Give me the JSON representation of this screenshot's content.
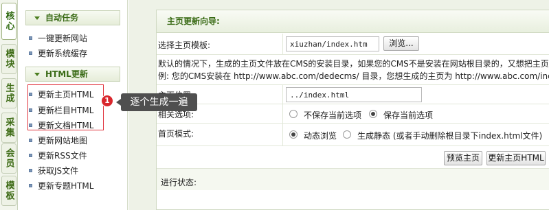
{
  "vertical_tabs": [
    {
      "label": "核心",
      "active": true
    },
    {
      "label": "模块",
      "active": false
    },
    {
      "label": "生成",
      "active": false
    },
    {
      "label": "采集",
      "active": false
    },
    {
      "label": "会员",
      "active": false
    },
    {
      "label": "模板",
      "active": false
    }
  ],
  "menu": {
    "section1": {
      "title": "自动任务",
      "items": [
        "一键更新网站",
        "更新系统缓存"
      ]
    },
    "section2": {
      "title": "HTML更新",
      "items": [
        "更新主页HTML",
        "更新栏目HTML",
        "更新文档HTML",
        "更新网站地图",
        "更新RSS文件",
        "获取JS文件",
        "更新专题HTML"
      ]
    }
  },
  "annotation": {
    "badge": "1",
    "text": "逐个生成一遍"
  },
  "panel": {
    "title": "主页更新向导:",
    "template_label": "选择主页模板:",
    "template_value": "xiuzhan/index.htm",
    "browse_button": "浏览...",
    "note_line1": "默认的情况下，生成的主页文件放在CMS的安装目录，如果您的CMS不是安装在网站根目录的，又想把主页创建",
    "note_line2": "例: 您的CMS安装在 http://www.abc.com/dedecms/ 目录，您想生成的主页为 http://www.abc.com/index.h",
    "position_label": "主页位置:",
    "position_value": "../index.html",
    "options_label": "相关选项:",
    "option_no_save": "不保存当前选项",
    "option_save": "保存当前选项",
    "mode_label": "首页模式:",
    "mode_dynamic": "动态浏览",
    "mode_static": "生成静态 (或者手动删除根目录下index.html文件)",
    "preview_button": "预览主页",
    "update_button": "更新主页HTML",
    "progress_label": "进行状态:"
  },
  "colors": {
    "accent_green": "#3a6b16",
    "highlight_red": "#e0303a",
    "badge_red": "#d9262c",
    "callout_gray": "#4f4f4f"
  }
}
